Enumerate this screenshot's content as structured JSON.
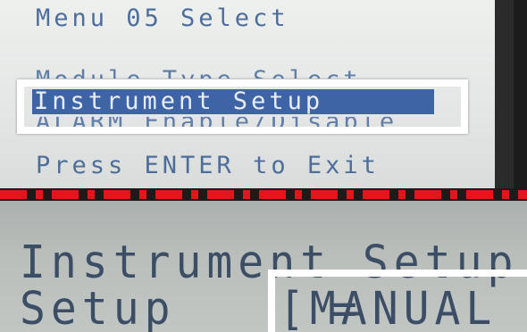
{
  "top_screen": {
    "title": "Menu 05 Select",
    "items": [
      {
        "label": "Module Type Select"
      },
      {
        "label": "Instrument Setup"
      },
      {
        "label": "ALARM Enable/Disable"
      }
    ],
    "footer": "Press ENTER to Exit"
  },
  "bottom_screen": {
    "title": "Instrument Setup",
    "field_label": "Setup",
    "equals": "=",
    "field_value": "[MANUAL  ]"
  },
  "colors": {
    "lcd_text": "#4d6e9b",
    "selection_bg": "#3f64a6",
    "divider_red": "#e8141b",
    "highlight_border": "#ffffff"
  }
}
